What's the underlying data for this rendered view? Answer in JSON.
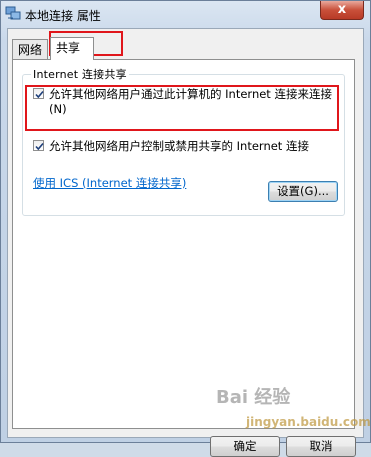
{
  "window": {
    "title": "本地连接 属性",
    "close_glyph": "x"
  },
  "tabs": [
    {
      "label": "网络",
      "active": false
    },
    {
      "label": "共享",
      "active": true
    }
  ],
  "sharing": {
    "group_title": "Internet 连接共享",
    "allow_connect_label": "允许其他网络用户通过此计算机的 Internet 连接来连接(N)",
    "allow_connect_checked": true,
    "allow_control_label": "允许其他网络用户控制或禁用共享的 Internet 连接",
    "allow_control_checked": true,
    "ics_link": "使用 ICS (Internet 连接共享)",
    "settings_button": "设置(G)..."
  },
  "footer": {
    "ok_label": "确定",
    "cancel_label": "取消"
  },
  "watermark": {
    "text": "Bai 经验",
    "sub": "jingyan.baidu.com"
  },
  "colors": {
    "annotation": "#e0161b",
    "link": "#0066cc"
  }
}
